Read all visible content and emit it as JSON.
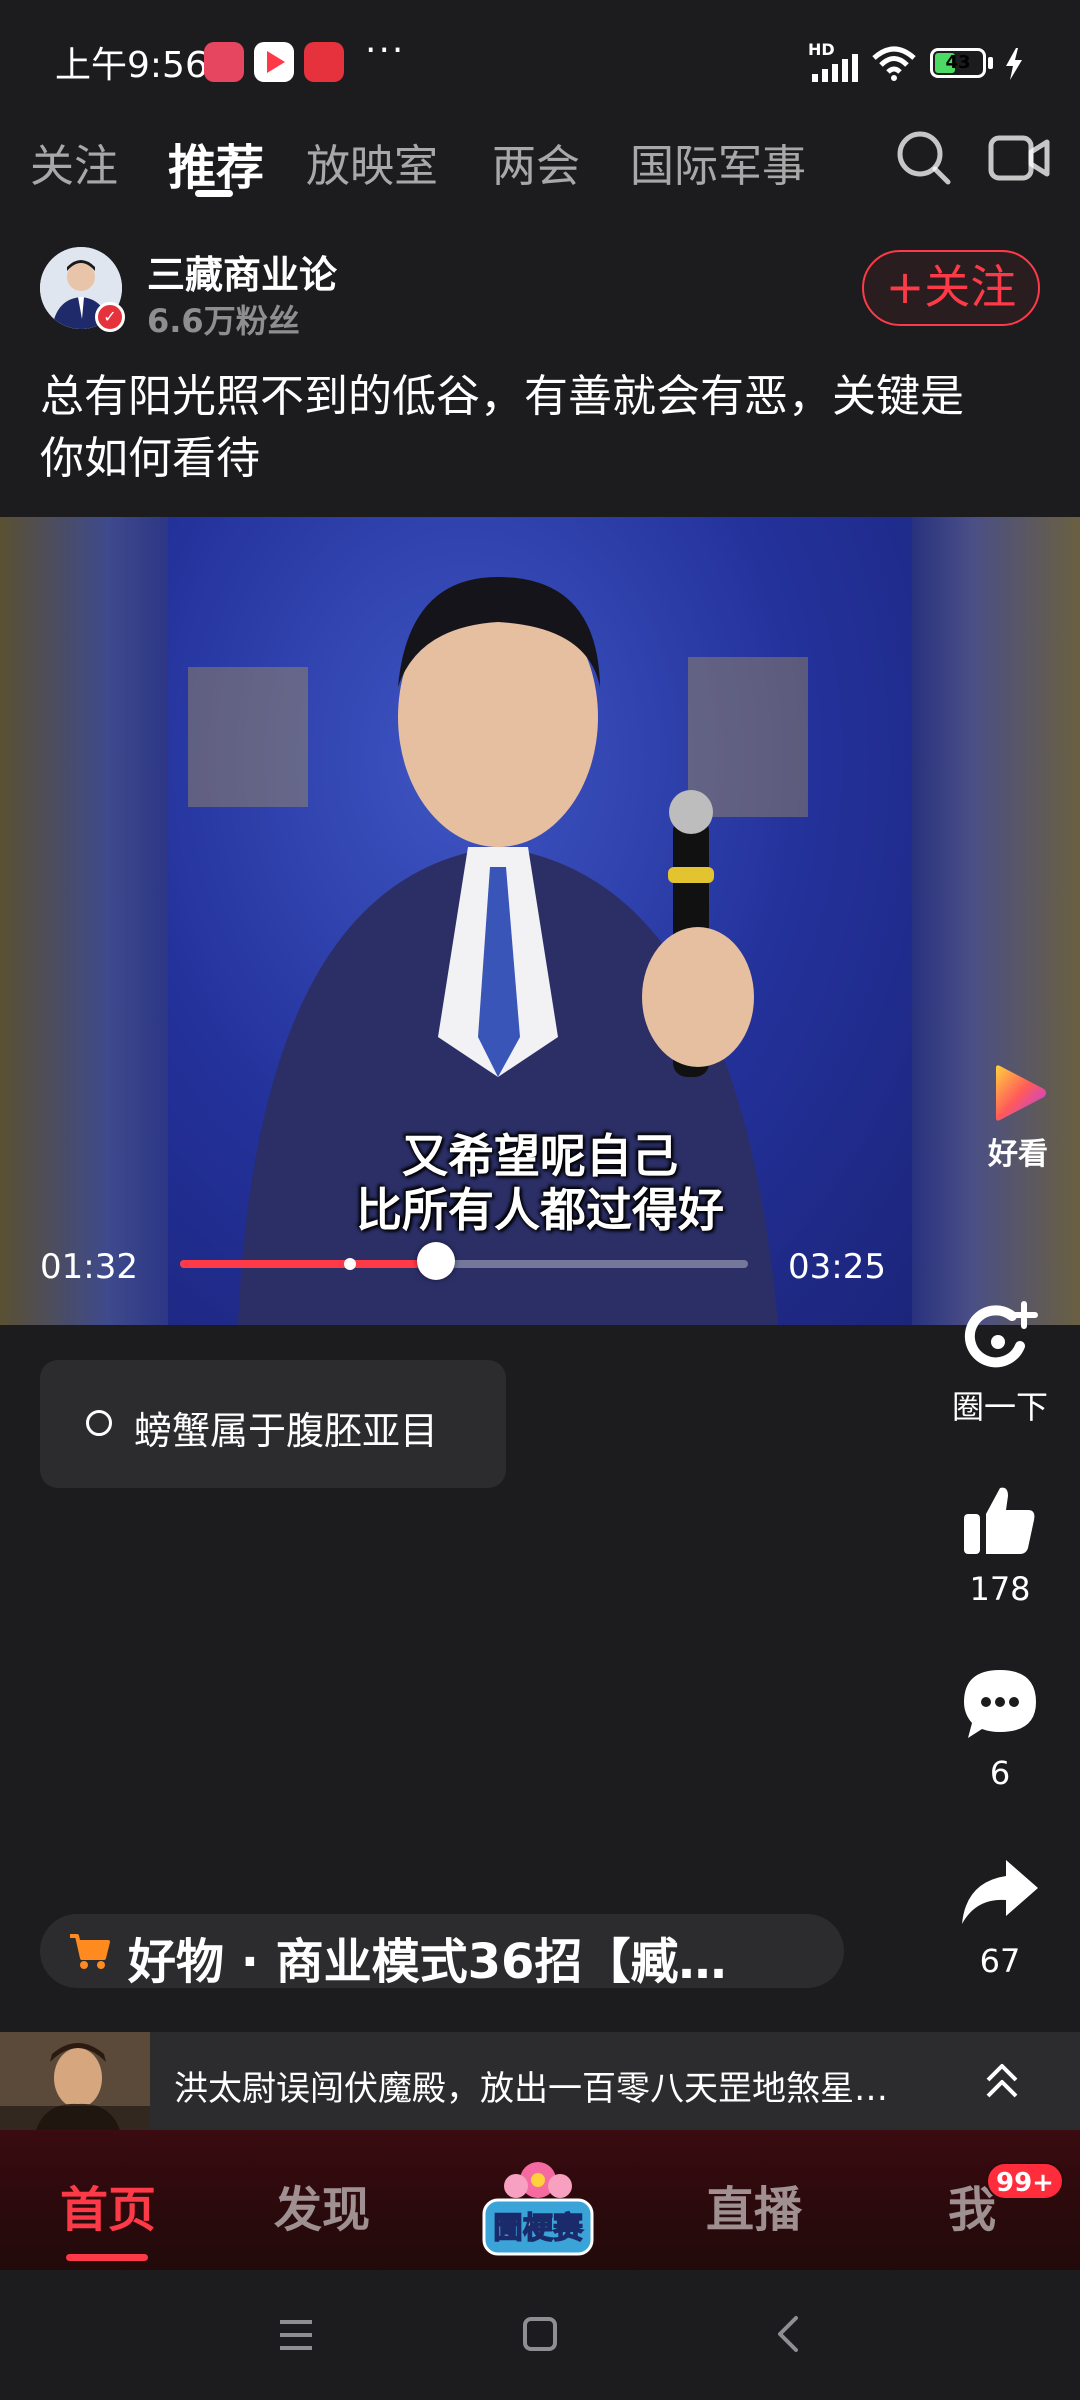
{
  "status_bar": {
    "time": "上午9:56",
    "more": "···",
    "network": "HD",
    "battery": "43",
    "battery_level": 0.43
  },
  "top_nav": {
    "tabs": [
      "关注",
      "推荐",
      "放映室",
      "两会",
      "国际军事"
    ],
    "active_index": 1
  },
  "author": {
    "name": "三藏商业论",
    "fans": "6.6万粉丝",
    "follow_label": "+关注"
  },
  "caption_line1": "总有阳光照不到的低谷，有善就会有恶，关键是",
  "caption_line2": "你如何看待",
  "video": {
    "subtitle_line1": "又希望呢自己",
    "subtitle_line2": "比所有人都过得好",
    "current_time": "01:32",
    "total_time": "03:25",
    "progress": 0.45,
    "buffer_marker": 0.3,
    "brand_label": "好看"
  },
  "quiz": {
    "text": "螃蟹属于腹胚亚目"
  },
  "actions": {
    "circle_label": "圈一下",
    "like_count": "178",
    "comment_count": "6",
    "share_count": "67"
  },
  "product": {
    "label": "好物 · 商业模式36招【臧…"
  },
  "drama": {
    "text": "洪太尉误闯伏魔殿，放出一百零八天罡地煞星…"
  },
  "bottom_tabs": {
    "home": "首页",
    "discover": "发现",
    "event": "圊梗赛",
    "live": "直播",
    "me": "我",
    "badge": "99+"
  },
  "colors": {
    "accent": "#ff3a48",
    "background": "#1c1c1e",
    "card": "#2c2c2e"
  }
}
